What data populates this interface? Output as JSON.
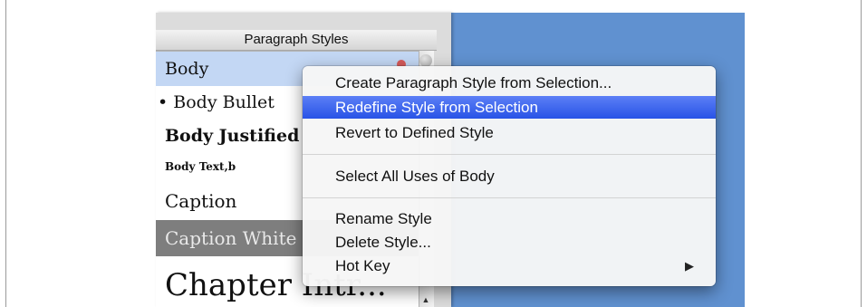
{
  "panel": {
    "title": "Paragraph Styles",
    "styles": [
      {
        "label": "Body"
      },
      {
        "label": "Body Bullet",
        "bullet": "•"
      },
      {
        "label": "Body Justified"
      },
      {
        "label": "Body Text,b"
      },
      {
        "label": "Caption"
      },
      {
        "label": "Caption White"
      },
      {
        "label": "Chapter Intr..."
      }
    ],
    "scroll_up_arrow": "▲"
  },
  "context_menu": {
    "items": [
      {
        "label": "Create Paragraph Style from Selection..."
      },
      {
        "label": "Redefine Style from Selection"
      },
      {
        "label": "Revert to Defined Style"
      },
      {
        "label": "Select All Uses of Body"
      },
      {
        "label": "Rename Style"
      },
      {
        "label": "Delete Style..."
      },
      {
        "label": "Hot Key",
        "submenu_arrow": "▶"
      }
    ]
  },
  "colors": {
    "desktop": "#6091d0",
    "selection": "#c3d7f4",
    "menu_highlight": "#2853e6"
  }
}
